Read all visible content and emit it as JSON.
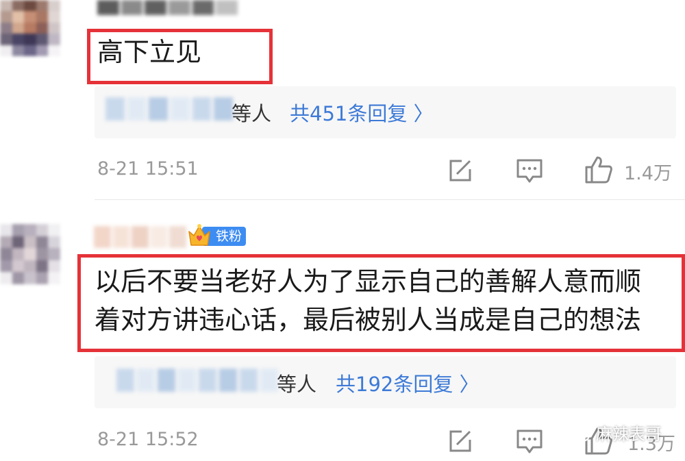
{
  "comments": [
    {
      "text": "高下立见",
      "replies": {
        "who_suffix": "等人",
        "link": "共451条回复 〉"
      },
      "time": "8-21 15:51",
      "likes": "1.4万"
    },
    {
      "badge": "铁粉",
      "text_lines": [
        "以后不要当老好人为了显示自己的善解人意而顺",
        "着对方讲违心话，最后被别人当成是自己的想法"
      ],
      "replies": {
        "who_suffix": "等人",
        "link": "共192条回复 〉"
      },
      "time": "8-21 15:52",
      "likes": "1.3万"
    }
  ],
  "watermark": "麻辣表哥",
  "colors": {
    "highlight_border": "#e53238",
    "link": "#3d7ad7",
    "meta_gray": "#999999",
    "badge": "#3d8cf2"
  },
  "icons": [
    "repost-icon",
    "comment-icon",
    "thumbs-up-icon",
    "crown-icon",
    "wechat-icon"
  ]
}
